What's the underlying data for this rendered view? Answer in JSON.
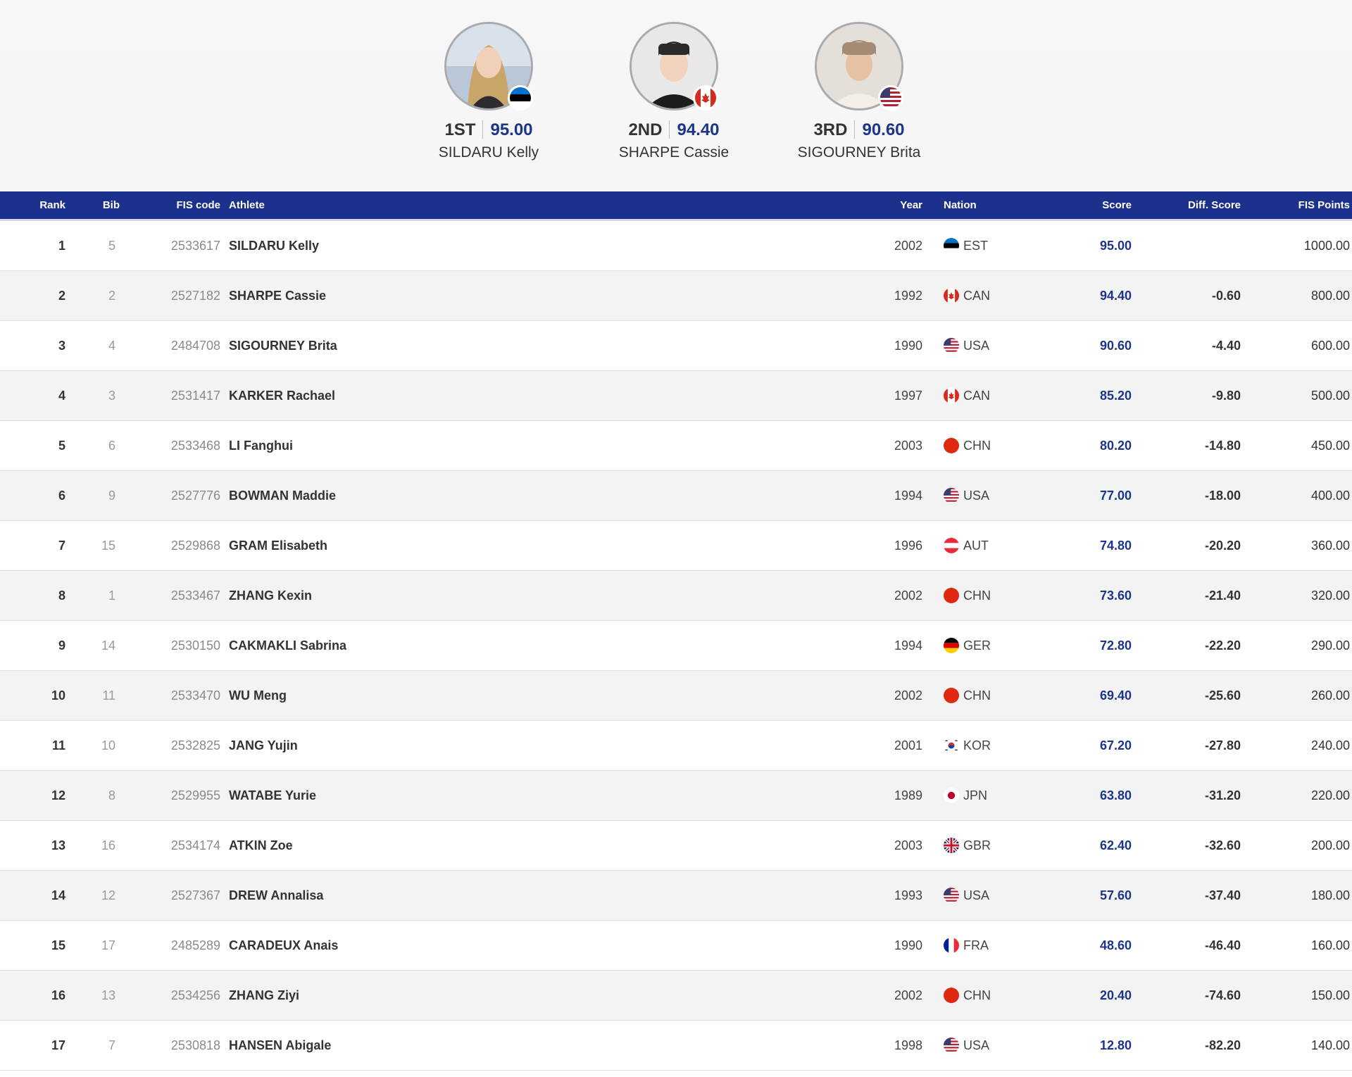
{
  "podium": [
    {
      "place": "1ST",
      "score": "95.00",
      "name": "SILDARU Kelly",
      "nation": "EST"
    },
    {
      "place": "2ND",
      "score": "94.40",
      "name": "SHARPE Cassie",
      "nation": "CAN"
    },
    {
      "place": "3RD",
      "score": "90.60",
      "name": "SIGOURNEY Brita",
      "nation": "USA"
    }
  ],
  "table": {
    "headers": {
      "rank": "Rank",
      "bib": "Bib",
      "fis_code": "FIS code",
      "athlete": "Athlete",
      "year": "Year",
      "nation": "Nation",
      "score": "Score",
      "diff": "Diff. Score",
      "fis_points": "FIS Points"
    },
    "rows": [
      {
        "rank": "1",
        "bib": "5",
        "fis": "2533617",
        "athlete": "SILDARU Kelly",
        "year": "2002",
        "nation": "EST",
        "score": "95.00",
        "diff": "",
        "pts": "1000.00"
      },
      {
        "rank": "2",
        "bib": "2",
        "fis": "2527182",
        "athlete": "SHARPE Cassie",
        "year": "1992",
        "nation": "CAN",
        "score": "94.40",
        "diff": "-0.60",
        "pts": "800.00"
      },
      {
        "rank": "3",
        "bib": "4",
        "fis": "2484708",
        "athlete": "SIGOURNEY Brita",
        "year": "1990",
        "nation": "USA",
        "score": "90.60",
        "diff": "-4.40",
        "pts": "600.00"
      },
      {
        "rank": "4",
        "bib": "3",
        "fis": "2531417",
        "athlete": "KARKER Rachael",
        "year": "1997",
        "nation": "CAN",
        "score": "85.20",
        "diff": "-9.80",
        "pts": "500.00"
      },
      {
        "rank": "5",
        "bib": "6",
        "fis": "2533468",
        "athlete": "LI Fanghui",
        "year": "2003",
        "nation": "CHN",
        "score": "80.20",
        "diff": "-14.80",
        "pts": "450.00"
      },
      {
        "rank": "6",
        "bib": "9",
        "fis": "2527776",
        "athlete": "BOWMAN Maddie",
        "year": "1994",
        "nation": "USA",
        "score": "77.00",
        "diff": "-18.00",
        "pts": "400.00"
      },
      {
        "rank": "7",
        "bib": "15",
        "fis": "2529868",
        "athlete": "GRAM Elisabeth",
        "year": "1996",
        "nation": "AUT",
        "score": "74.80",
        "diff": "-20.20",
        "pts": "360.00"
      },
      {
        "rank": "8",
        "bib": "1",
        "fis": "2533467",
        "athlete": "ZHANG Kexin",
        "year": "2002",
        "nation": "CHN",
        "score": "73.60",
        "diff": "-21.40",
        "pts": "320.00"
      },
      {
        "rank": "9",
        "bib": "14",
        "fis": "2530150",
        "athlete": "CAKMAKLI Sabrina",
        "year": "1994",
        "nation": "GER",
        "score": "72.80",
        "diff": "-22.20",
        "pts": "290.00"
      },
      {
        "rank": "10",
        "bib": "11",
        "fis": "2533470",
        "athlete": "WU Meng",
        "year": "2002",
        "nation": "CHN",
        "score": "69.40",
        "diff": "-25.60",
        "pts": "260.00"
      },
      {
        "rank": "11",
        "bib": "10",
        "fis": "2532825",
        "athlete": "JANG Yujin",
        "year": "2001",
        "nation": "KOR",
        "score": "67.20",
        "diff": "-27.80",
        "pts": "240.00"
      },
      {
        "rank": "12",
        "bib": "8",
        "fis": "2529955",
        "athlete": "WATABE Yurie",
        "year": "1989",
        "nation": "JPN",
        "score": "63.80",
        "diff": "-31.20",
        "pts": "220.00"
      },
      {
        "rank": "13",
        "bib": "16",
        "fis": "2534174",
        "athlete": "ATKIN Zoe",
        "year": "2003",
        "nation": "GBR",
        "score": "62.40",
        "diff": "-32.60",
        "pts": "200.00"
      },
      {
        "rank": "14",
        "bib": "12",
        "fis": "2527367",
        "athlete": "DREW Annalisa",
        "year": "1993",
        "nation": "USA",
        "score": "57.60",
        "diff": "-37.40",
        "pts": "180.00"
      },
      {
        "rank": "15",
        "bib": "17",
        "fis": "2485289",
        "athlete": "CARADEUX Anais",
        "year": "1990",
        "nation": "FRA",
        "score": "48.60",
        "diff": "-46.40",
        "pts": "160.00"
      },
      {
        "rank": "16",
        "bib": "13",
        "fis": "2534256",
        "athlete": "ZHANG Ziyi",
        "year": "2002",
        "nation": "CHN",
        "score": "20.40",
        "diff": "-74.60",
        "pts": "150.00"
      },
      {
        "rank": "17",
        "bib": "7",
        "fis": "2530818",
        "athlete": "HANSEN Abigale",
        "year": "1998",
        "nation": "USA",
        "score": "12.80",
        "diff": "-82.20",
        "pts": "140.00"
      }
    ]
  },
  "colors": {
    "header_bg": "#1b318c",
    "score_accent": "#1d3588"
  }
}
